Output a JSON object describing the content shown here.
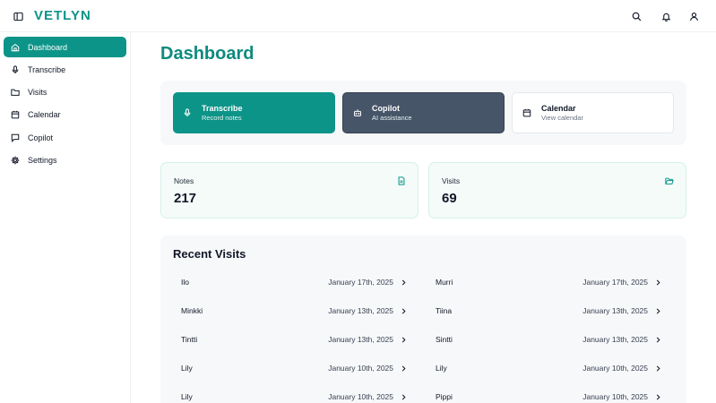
{
  "app": {
    "brand": "VETLYN"
  },
  "topbar": {
    "icons": [
      "sidebar-toggle-icon",
      "search-icon",
      "bell-icon",
      "user-icon"
    ]
  },
  "sidebar": {
    "items": [
      {
        "label": "Dashboard",
        "icon": "home-icon",
        "active": true
      },
      {
        "label": "Transcribe",
        "icon": "microphone-icon",
        "active": false
      },
      {
        "label": "Visits",
        "icon": "folder-icon",
        "active": false
      },
      {
        "label": "Calendar",
        "icon": "calendar-icon",
        "active": false
      },
      {
        "label": "Copilot",
        "icon": "message-icon",
        "active": false
      },
      {
        "label": "Settings",
        "icon": "gear-icon",
        "active": false
      }
    ]
  },
  "main": {
    "title": "Dashboard",
    "quick_actions": [
      {
        "title": "Transcribe",
        "subtitle": "Record notes",
        "icon": "microphone-icon"
      },
      {
        "title": "Copilot",
        "subtitle": "AI assistance",
        "icon": "bot-icon"
      },
      {
        "title": "Calendar",
        "subtitle": "View calendar",
        "icon": "calendar-icon"
      }
    ],
    "stats": [
      {
        "label": "Notes",
        "value": "217",
        "icon": "file-text-icon"
      },
      {
        "label": "Visits",
        "value": "69",
        "icon": "folder-open-icon"
      }
    ],
    "recent": {
      "title": "Recent Visits",
      "left": [
        {
          "name": "Ilo",
          "date": "January 17th, 2025"
        },
        {
          "name": "Minkki",
          "date": "January 13th, 2025"
        },
        {
          "name": "Tintti",
          "date": "January 13th, 2025"
        },
        {
          "name": "Lily",
          "date": "January 10th, 2025"
        },
        {
          "name": "Lily",
          "date": "January 10th, 2025"
        }
      ],
      "right": [
        {
          "name": "Murri",
          "date": "January 17th, 2025"
        },
        {
          "name": "Tiina",
          "date": "January 13th, 2025"
        },
        {
          "name": "Sintti",
          "date": "January 13th, 2025"
        },
        {
          "name": "Lily",
          "date": "January 10th, 2025"
        },
        {
          "name": "Pippi",
          "date": "January 10th, 2025"
        }
      ]
    }
  },
  "colors": {
    "accent": "#0d9488",
    "slate": "#475569"
  }
}
